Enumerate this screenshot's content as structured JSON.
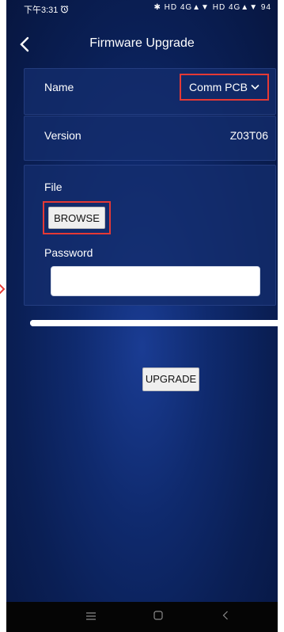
{
  "status_bar": {
    "time": "下午3:31",
    "alarm_icon": "alarm-clock-icon",
    "right_icons": "✱ HD 4G▲▼ HD 4G▲▼ 94"
  },
  "header": {
    "back_icon": "chevron-left-icon",
    "title": "Firmware Upgrade"
  },
  "device": {
    "name_label": "Name",
    "name_value": "Comm PCB",
    "name_dropdown_icon": "chevron-down-icon",
    "version_label": "Version",
    "version_value": "Z03T06"
  },
  "upgrade_form": {
    "file_label": "File",
    "browse_label": "BROWSE",
    "password_label": "Password",
    "password_value": "",
    "upgrade_label": "UPGRADE"
  },
  "progress": {
    "percent": 100
  },
  "nav_bar": {
    "menu_icon": "menu-lines-icon",
    "home_icon": "square-home-icon",
    "back_icon": "triangle-back-icon"
  },
  "highlight_color": "#e53935",
  "background_color": "#0f2a6e"
}
